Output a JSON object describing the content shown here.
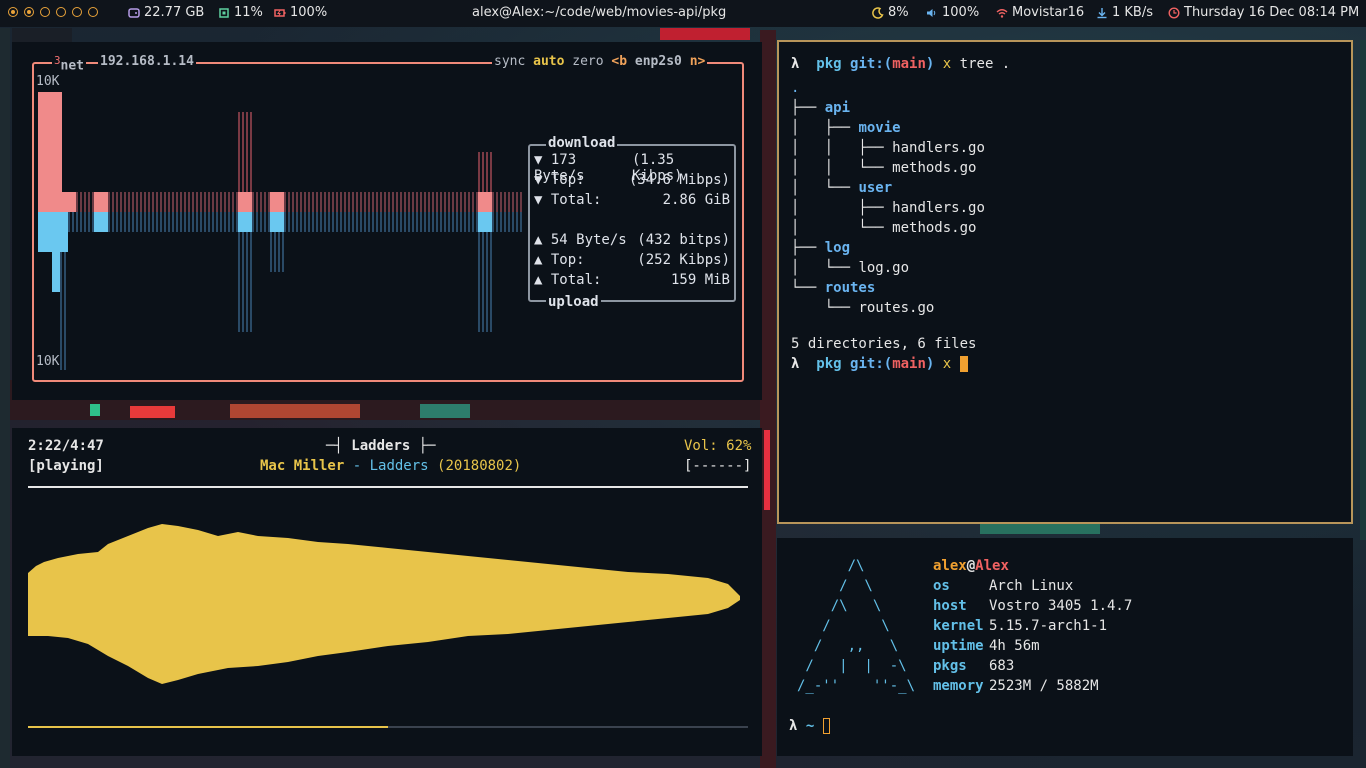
{
  "topbar": {
    "storage": "22.77 GB",
    "cpu": "11%",
    "battery": "100%",
    "title": "alex@Alex:~/code/web/movies-api/pkg",
    "brightness": "8%",
    "volume": "100%",
    "wifi": "Movistar16",
    "netspeed": "1 KB/s",
    "clock": "Thursday 16 Dec 08:14 PM"
  },
  "net": {
    "title_num": "3",
    "title": "net",
    "ip": "192.168.1.14",
    "sync": "sync",
    "auto": "auto",
    "zero": "zero",
    "iface_prev": "<b",
    "iface": "enp2s0",
    "iface_next": "n>",
    "scale_top": "10K",
    "scale_bottom": "10K",
    "download_label": "download",
    "upload_label": "upload",
    "dl_rate": "173 Byte/s",
    "dl_rate_bits": "(1.35 Kibps)",
    "dl_top_label": "Top:",
    "dl_top": "(34.6 Mibps)",
    "dl_total_label": "Total:",
    "dl_total": "2.86 GiB",
    "ul_rate": "54 Byte/s",
    "ul_rate_bits": "(432 bitps)",
    "ul_top_label": "Top:",
    "ul_top": "(252 Kibps)",
    "ul_total_label": "Total:",
    "ul_total": "159 MiB"
  },
  "music": {
    "time": "2:22/4:47",
    "state": "[playing]",
    "track_title": "Ladders",
    "artist": "Mac Miller",
    "sep": " - ",
    "song": "Ladders",
    "date": "(20180802)",
    "volume": "Vol: 62%",
    "volbar": "[------]",
    "progress": 0.5
  },
  "terminal": {
    "prompt": "λ",
    "dir": "pkg",
    "git": "git:(",
    "branch": "main",
    "git_close": ")",
    "dirty": "x",
    "command": "tree .",
    "tree": [
      {
        "prefix": ".",
        "name": "",
        "dir": false
      },
      {
        "prefix": "├── ",
        "name": "api",
        "dir": true
      },
      {
        "prefix": "│   ├── ",
        "name": "movie",
        "dir": true
      },
      {
        "prefix": "│   │   ├── ",
        "name": "handlers.go",
        "dir": false
      },
      {
        "prefix": "│   │   └── ",
        "name": "methods.go",
        "dir": false
      },
      {
        "prefix": "│   └── ",
        "name": "user",
        "dir": true
      },
      {
        "prefix": "│       ├── ",
        "name": "handlers.go",
        "dir": false
      },
      {
        "prefix": "│       └── ",
        "name": "methods.go",
        "dir": false
      },
      {
        "prefix": "├── ",
        "name": "log",
        "dir": true
      },
      {
        "prefix": "│   └── ",
        "name": "log.go",
        "dir": false
      },
      {
        "prefix": "└── ",
        "name": "routes",
        "dir": true
      },
      {
        "prefix": "    └── ",
        "name": "routes.go",
        "dir": false
      }
    ],
    "summary": "5 directories, 6 files"
  },
  "fetch": {
    "user": "alex",
    "at": "@",
    "host_name": "Alex",
    "rows": [
      {
        "k": "os",
        "v": "Arch Linux"
      },
      {
        "k": "host",
        "v": "Vostro 3405 1.4.7"
      },
      {
        "k": "kernel",
        "v": "5.15.7-arch1-1"
      },
      {
        "k": "uptime",
        "v": "4h 56m"
      },
      {
        "k": "pkgs",
        "v": "683"
      },
      {
        "k": "memory",
        "v": "2523M / 5882M"
      }
    ],
    "logo": [
      "      /\\",
      "     /  \\",
      "    /\\   \\",
      "   /      \\",
      "  /   ,,   \\",
      " /   |  |  -\\",
      "/_-''    ''-_\\"
    ],
    "prompt": "λ",
    "cwd": "~"
  },
  "colors": {
    "accent": "#f08a7a",
    "gold": "#e8c44a",
    "terminal_border": "#b8955a"
  }
}
